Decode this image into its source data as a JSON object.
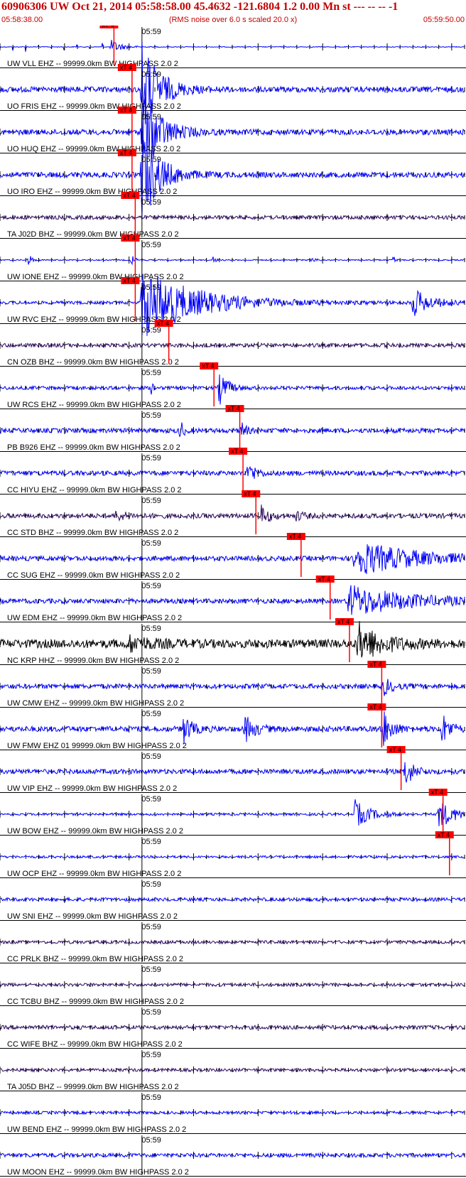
{
  "header": {
    "title": "60906306 UW Oct 21, 2014 05:58:58.00   45.4632 -121.6804  1.2 0.00 Mn st --- -- --   -1",
    "start_time": "05:58:38.00",
    "noise_note": "(RMS noise over 6.0 s scaled 20.0 x)",
    "end_time": "05:59:50.00"
  },
  "colors": {
    "header_red": "#c40000",
    "trace_blue": "#0000ff",
    "trace_purple": "#2a0a5e",
    "trace_black": "#000000",
    "pick_red": "#ff0000"
  },
  "chart_data": {
    "type": "line",
    "title": "60906306 UW Oct 21, 2014 05:58:58.00   45.4632 -121.6804  1.2 0.00 Mn st --- -- --   -1",
    "x_start": "05:58:38.00",
    "x_end": "05:59:50.00",
    "x_range_seconds": [
      0,
      72
    ],
    "major_tick_label": "05:59",
    "major_tick_seconds": 22,
    "pick_label": "xT 4",
    "filter": "HIGHPASS  2.0  2",
    "grid": "ticks",
    "traces": [
      {
        "label": "UW VLL EHZ -- 99999.0km BW  HIGHPASS  2.0  2",
        "color": "blue",
        "pick_s": 17.0,
        "bursts": [
          [
            17.3,
            1.6,
            0.9
          ]
        ],
        "noise": 0.05,
        "spikes": true
      },
      {
        "label": "UO FRIS EHZ -- 99999.0km BW  HIGHPASS  2.0  2",
        "color": "blue",
        "pick_s": 19.8,
        "bursts": [
          [
            22.0,
            2.6,
            6.0
          ]
        ],
        "noise": 0.35
      },
      {
        "label": "UO HUQ EHZ -- 99999.0km BW  HIGHPASS  2.0  2",
        "color": "blue",
        "pick_s": 19.8,
        "bursts": [
          [
            22.0,
            2.6,
            6.0
          ]
        ],
        "noise": 0.35
      },
      {
        "label": "UO IRO EHZ -- 99999.0km BW  HIGHPASS  2.0  2",
        "color": "blue",
        "pick_s": 19.8,
        "bursts": [
          [
            22.0,
            2.6,
            6.0
          ]
        ],
        "noise": 0.35
      },
      {
        "label": "TA J02D BHZ -- 99999.0km BW  HIGHPASS  2.0  2",
        "color": "purple",
        "pick_s": 20.3,
        "bursts": [],
        "noise": 0.25
      },
      {
        "label": "UW IONE EHZ -- 99999.0km BW  HIGHPASS  2.0  2",
        "color": "blue",
        "pick_s": 20.3,
        "bursts": [
          [
            4.5,
            0.4,
            0.9
          ],
          [
            20.5,
            0.4,
            0.8
          ],
          [
            33.0,
            0.3,
            0.7
          ],
          [
            48.5,
            0.3,
            0.8
          ],
          [
            61.0,
            0.3,
            0.5
          ]
        ],
        "noise": 0.08
      },
      {
        "label": "UW RVC EHZ -- 99999.0km BW  HIGHPASS  2.0  2",
        "color": "blue",
        "pick_s": 20.3,
        "bursts": [
          [
            22.0,
            8.0,
            4.5
          ],
          [
            64.0,
            2.5,
            1.8
          ]
        ],
        "noise": 0.2
      },
      {
        "label": "CN OZB BHZ -- 99999.0km BW  HIGHPASS  2.0  2",
        "color": "purple",
        "pick_s": 25.5,
        "bursts": [],
        "noise": 0.25
      },
      {
        "label": "UW RCS EHZ -- 99999.0km BW  HIGHPASS  2.0  2",
        "color": "blue",
        "pick_s": 32.5,
        "bursts": [
          [
            34.0,
            1.2,
            2.2
          ],
          [
            23.5,
            0.3,
            0.8
          ]
        ],
        "noise": 0.22
      },
      {
        "label": "PB B926 EHZ -- 99999.0km BW  HIGHPASS  2.0  2",
        "color": "blue",
        "pick_s": 36.5,
        "bursts": [
          [
            28.0,
            0.4,
            1.4
          ],
          [
            37.5,
            0.6,
            1.2
          ]
        ],
        "noise": 0.3
      },
      {
        "label": "CC HIYU EHZ -- 99999.0km BW  HIGHPASS  2.0  2",
        "color": "blue",
        "pick_s": 37.0,
        "bursts": [
          [
            38.5,
            1.0,
            1.5
          ]
        ],
        "noise": 0.3
      },
      {
        "label": "CC STD BHZ -- 99999.0km BW  HIGHPASS  2.0  2",
        "color": "purple",
        "pick_s": 39.0,
        "bursts": [
          [
            40.5,
            1.2,
            1.2
          ],
          [
            18.0,
            1.5,
            0.6
          ],
          [
            46.0,
            1.0,
            0.6
          ]
        ],
        "noise": 0.3
      },
      {
        "label": "CC SUG EHZ -- 99999.0km BW  HIGHPASS  2.0  2",
        "color": "blue",
        "pick_s": 46.0,
        "bursts": [
          [
            55.0,
            9.0,
            2.2
          ]
        ],
        "noise": 0.3
      },
      {
        "label": "UW EDM EHZ -- 99999.0km BW  HIGHPASS  2.0  2",
        "color": "blue",
        "pick_s": 50.5,
        "bursts": [
          [
            54.0,
            9.0,
            2.0
          ]
        ],
        "noise": 0.3
      },
      {
        "label": "NC KRP HHZ -- 99999.0km BW  HIGHPASS  2.0  2",
        "color": "black",
        "pick_s": 53.5,
        "bursts": [
          [
            55.5,
            3.5,
            2.5
          ],
          [
            20.0,
            3.0,
            0.9
          ]
        ],
        "noise": 0.55
      },
      {
        "label": "UW CMW EHZ -- 99999.0km BW  HIGHPASS  2.0  2",
        "color": "blue",
        "pick_s": 58.5,
        "bursts": [
          [
            59.5,
            1.2,
            1.1
          ]
        ],
        "noise": 0.3
      },
      {
        "label": "UW FMW EHZ 01 99999.0km BW  HIGHPASS  2.0  2",
        "color": "blue",
        "pick_s": 58.5,
        "bursts": [
          [
            28.5,
            1.2,
            1.8
          ],
          [
            38.0,
            1.5,
            1.6
          ],
          [
            59.5,
            1.2,
            2.5
          ],
          [
            68.5,
            1.2,
            2.0
          ]
        ],
        "noise": 0.35
      },
      {
        "label": "UW VIP EHZ -- 99999.0km BW  HIGHPASS  2.0  2",
        "color": "blue",
        "pick_s": 61.5,
        "bursts": [
          [
            62.8,
            1.2,
            2.0
          ]
        ],
        "noise": 0.3
      },
      {
        "label": "UW BOW EHZ -- 99999.0km BW  HIGHPASS  2.0  2",
        "color": "blue",
        "pick_s": 68.0,
        "bursts": [
          [
            55.0,
            2.2,
            1.8
          ],
          [
            68.0,
            2.5,
            1.8
          ]
        ],
        "noise": 0.15
      },
      {
        "label": "UW OCP EHZ -- 99999.0km BW  HIGHPASS  2.0  2",
        "color": "blue",
        "pick_s": 69.0,
        "bursts": [],
        "noise": 0.15
      },
      {
        "label": "UW SNI EHZ -- 99999.0km BW  HIGHPASS  2.0  2",
        "color": "blue",
        "pick_s": null,
        "bursts": [],
        "noise": 0.22
      },
      {
        "label": "CC PRLK BHZ -- 99999.0km BW  HIGHPASS  2.0  2",
        "color": "purple",
        "pick_s": null,
        "bursts": [],
        "noise": 0.2
      },
      {
        "label": "CC TCBU BHZ -- 99999.0km BW  HIGHPASS  2.0  2",
        "color": "purple",
        "pick_s": null,
        "bursts": [],
        "noise": 0.2
      },
      {
        "label": "CC WIFE BHZ -- 99999.0km BW  HIGHPASS  2.0  2",
        "color": "purple",
        "pick_s": null,
        "bursts": [],
        "noise": 0.25
      },
      {
        "label": "TA J05D BHZ -- 99999.0km BW  HIGHPASS  2.0  2",
        "color": "purple",
        "pick_s": null,
        "bursts": [],
        "noise": 0.2
      },
      {
        "label": "UW BEND EHZ -- 99999.0km BW  HIGHPASS  2.0  2",
        "color": "blue",
        "pick_s": null,
        "bursts": [
          [
            45.0,
            0.3,
            0.6
          ]
        ],
        "noise": 0.18
      },
      {
        "label": "UW MOON EHZ -- 99999.0km BW  HIGHPASS  2.0  2",
        "color": "blue",
        "pick_s": null,
        "bursts": [],
        "noise": 0.25
      }
    ]
  }
}
